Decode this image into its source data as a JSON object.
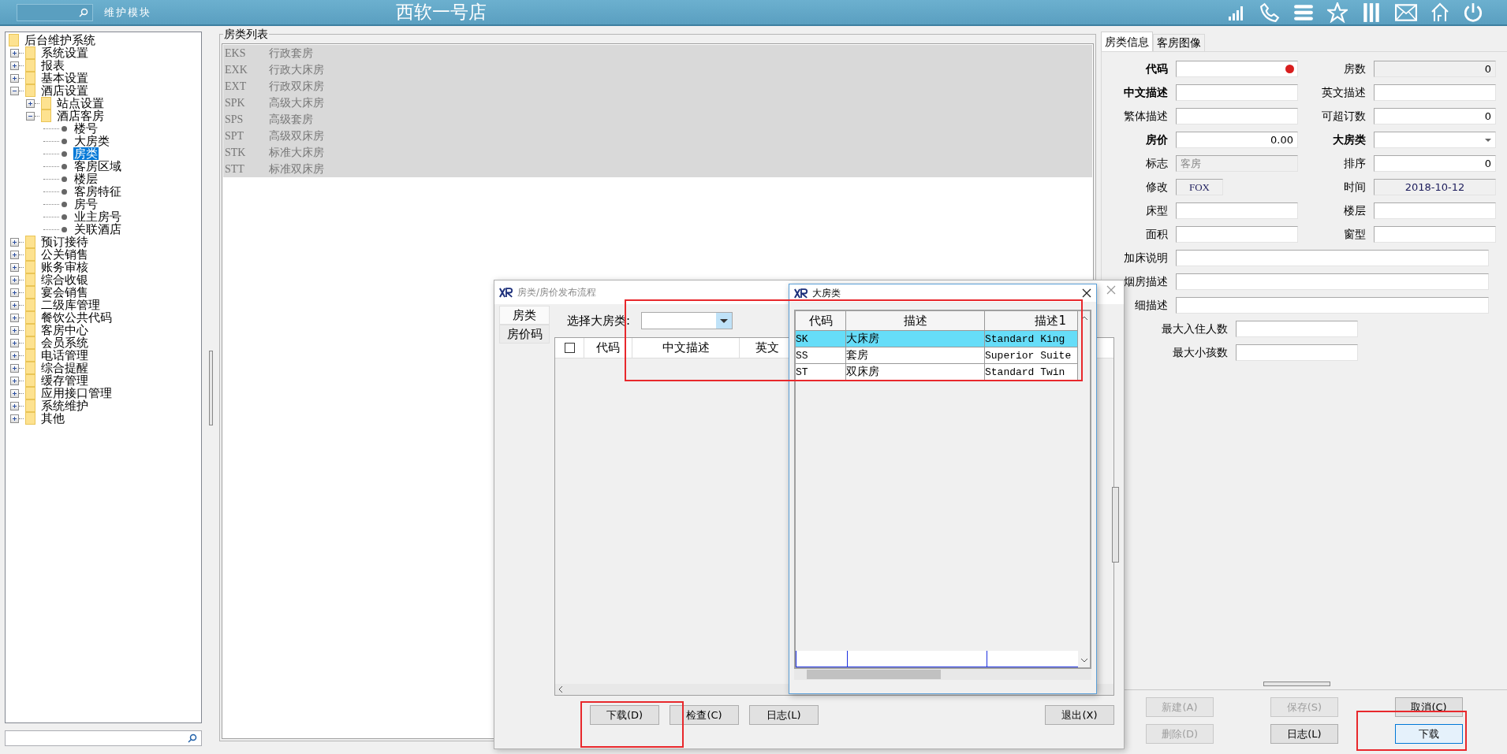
{
  "top_bar": {
    "module_label": "维护模块",
    "title": "西软一号店"
  },
  "tree": {
    "items": [
      {
        "label": "后台维护系统",
        "kind": "folder",
        "expanded": true,
        "selected": false,
        "children": [
          {
            "label": "系统设置",
            "kind": "folder",
            "expanded": false,
            "selected": false
          },
          {
            "label": "报表",
            "kind": "folder",
            "expanded": false,
            "selected": false
          },
          {
            "label": "基本设置",
            "kind": "folder",
            "expanded": false,
            "selected": false
          },
          {
            "label": "酒店设置",
            "kind": "folder",
            "expanded": true,
            "selected": false,
            "children": [
              {
                "label": "站点设置",
                "kind": "folder",
                "expanded": false,
                "selected": false
              },
              {
                "label": "酒店客房",
                "kind": "folder",
                "expanded": true,
                "selected": false,
                "children": [
                  {
                    "label": "楼号",
                    "kind": "leaf",
                    "selected": false
                  },
                  {
                    "label": "大房类",
                    "kind": "leaf",
                    "selected": false
                  },
                  {
                    "label": "房类",
                    "kind": "leaf",
                    "selected": true
                  },
                  {
                    "label": "客房区域",
                    "kind": "leaf",
                    "selected": false
                  },
                  {
                    "label": "楼层",
                    "kind": "leaf",
                    "selected": false
                  },
                  {
                    "label": "客房特征",
                    "kind": "leaf",
                    "selected": false
                  },
                  {
                    "label": "房号",
                    "kind": "leaf",
                    "selected": false
                  },
                  {
                    "label": "业主房号",
                    "kind": "leaf",
                    "selected": false
                  },
                  {
                    "label": "关联酒店",
                    "kind": "leaf",
                    "selected": false
                  }
                ]
              }
            ]
          },
          {
            "label": "预订接待",
            "kind": "folder",
            "expanded": false,
            "selected": false
          },
          {
            "label": "公关销售",
            "kind": "folder",
            "expanded": false,
            "selected": false
          },
          {
            "label": "账务审核",
            "kind": "folder",
            "expanded": false,
            "selected": false
          },
          {
            "label": "综合收银",
            "kind": "folder",
            "expanded": false,
            "selected": false
          },
          {
            "label": "宴会销售",
            "kind": "folder",
            "expanded": false,
            "selected": false
          },
          {
            "label": "二级库管理",
            "kind": "folder",
            "expanded": false,
            "selected": false
          },
          {
            "label": "餐饮公共代码",
            "kind": "folder",
            "expanded": false,
            "selected": false
          },
          {
            "label": "客房中心",
            "kind": "folder",
            "expanded": false,
            "selected": false
          },
          {
            "label": "会员系统",
            "kind": "folder",
            "expanded": false,
            "selected": false
          },
          {
            "label": "电话管理",
            "kind": "folder",
            "expanded": false,
            "selected": false
          },
          {
            "label": "综合提醒",
            "kind": "folder",
            "expanded": false,
            "selected": false
          },
          {
            "label": "缓存管理",
            "kind": "folder",
            "expanded": false,
            "selected": false
          },
          {
            "label": "应用接口管理",
            "kind": "folder",
            "expanded": false,
            "selected": false
          },
          {
            "label": "系统维护",
            "kind": "folder",
            "expanded": false,
            "selected": false
          },
          {
            "label": "其他",
            "kind": "folder",
            "expanded": false,
            "selected": false
          }
        ]
      }
    ]
  },
  "room_type_list": {
    "title": "房类列表",
    "rows": [
      {
        "code": "EKS",
        "name": "行政套房"
      },
      {
        "code": "EXK",
        "name": "行政大床房"
      },
      {
        "code": "EXT",
        "name": "行政双床房"
      },
      {
        "code": "SPK",
        "name": "高级大床房"
      },
      {
        "code": "SPS",
        "name": "高级套房"
      },
      {
        "code": "SPT",
        "name": "高级双床房"
      },
      {
        "code": "STK",
        "name": "标准大床房"
      },
      {
        "code": "STT",
        "name": "标准双床房"
      }
    ]
  },
  "detail_panel": {
    "tabs": [
      {
        "label": "房类信息",
        "selected": true
      },
      {
        "label": "客房图像",
        "selected": false
      }
    ],
    "pairs": [
      [
        {
          "label": "代码",
          "kind": "text",
          "required": true,
          "readonly": false,
          "invalid": true
        },
        {
          "label": "房数",
          "kind": "number",
          "value": "0",
          "required": false,
          "readonly": true,
          "invalid": false
        }
      ],
      [
        {
          "label": "中文描述",
          "kind": "text",
          "required": true,
          "readonly": false,
          "invalid": false
        },
        {
          "label": "英文描述",
          "kind": "text",
          "required": false,
          "readonly": false,
          "invalid": false
        }
      ],
      [
        {
          "label": "繁体描述",
          "kind": "text",
          "required": false,
          "readonly": false,
          "invalid": false
        },
        {
          "label": "可超订数",
          "kind": "number",
          "value": "0",
          "required": false,
          "readonly": false,
          "invalid": false
        }
      ],
      [
        {
          "label": "房价",
          "kind": "number",
          "value": "0.00",
          "required": true,
          "readonly": false,
          "invalid": false
        },
        {
          "label": "大房类",
          "kind": "select",
          "required": true,
          "readonly": false,
          "invalid": false
        }
      ],
      [
        {
          "label": "标志",
          "kind": "text",
          "value": "客房",
          "required": false,
          "readonly": true,
          "invalid": false
        },
        {
          "label": "排序",
          "kind": "number",
          "value": "0",
          "required": false,
          "readonly": false,
          "invalid": false
        }
      ],
      [
        {
          "label": "修改",
          "kind": "short",
          "value": "FOX",
          "required": false,
          "readonly": true,
          "invalid": false
        },
        {
          "label": "时间",
          "kind": "date",
          "value": "2018-10-12",
          "required": false,
          "readonly": true,
          "invalid": false
        }
      ],
      [
        {
          "label": "床型",
          "kind": "text",
          "required": false,
          "readonly": false,
          "invalid": false
        },
        {
          "label": "楼层",
          "kind": "text",
          "required": false,
          "readonly": false,
          "invalid": false
        }
      ],
      [
        {
          "label": "面积",
          "kind": "text",
          "required": false,
          "readonly": false,
          "invalid": false
        },
        {
          "label": "窗型",
          "kind": "text",
          "required": false,
          "readonly": false,
          "invalid": false
        }
      ]
    ],
    "wide_fields": [
      {
        "label": "加床说明"
      },
      {
        "label": "烟房描述"
      },
      {
        "label": "细描述"
      }
    ],
    "count_fields": [
      {
        "label": "最大入住人数"
      },
      {
        "label": "最大小孩数"
      }
    ],
    "buttons": [
      {
        "label": "新建(A)",
        "disabled": true,
        "default": false
      },
      {
        "label": "保存(S)",
        "disabled": true,
        "default": false
      },
      {
        "label": "取消(C)",
        "disabled": false,
        "default": false
      },
      {
        "label": "删除(D)",
        "disabled": true,
        "default": false
      },
      {
        "label": "日志(L)",
        "disabled": false,
        "default": false
      },
      {
        "label": "下载",
        "disabled": false,
        "default": true
      }
    ]
  },
  "publish_dialog": {
    "title": "房类/房价发布流程",
    "tabs": [
      {
        "label": "房类",
        "selected": true
      },
      {
        "label": "房价码",
        "selected": false
      }
    ],
    "filter_label": "选择大房类:",
    "select_all": {
      "checked": false
    },
    "columns": [
      "代码",
      "中文描述",
      "英文"
    ],
    "buttons": [
      "下载(D)",
      "检查(C)",
      "日志(L)",
      "退出(X)"
    ]
  },
  "big_room_type_dialog": {
    "title": "大房类",
    "columns": [
      "代码",
      "描述",
      "描述1"
    ],
    "rows": [
      {
        "code": "SK",
        "description": "大床房",
        "description_1": "Standard King",
        "selected": true
      },
      {
        "code": "SS",
        "description": "套房",
        "description_1": "Superior Suite",
        "selected": false
      },
      {
        "code": "ST",
        "description": "双床房",
        "description_1": "Standard Twin",
        "selected": false
      }
    ]
  }
}
